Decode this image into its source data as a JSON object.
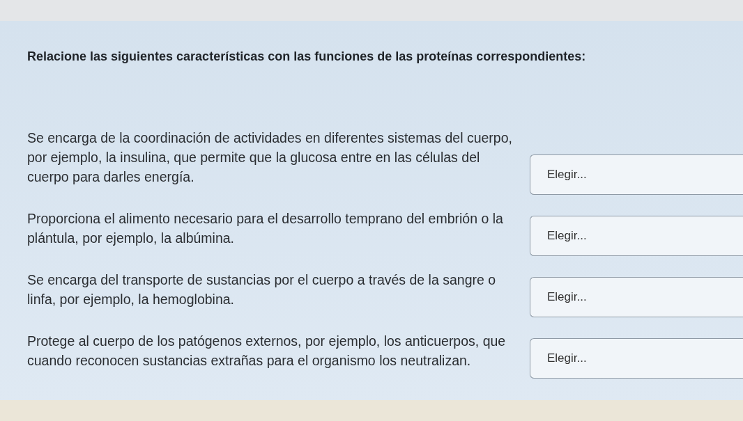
{
  "instruction": "Relacione las siguientes características con las funciones de las proteínas correspondientes:",
  "items": [
    {
      "statement": "Se encarga de la coordinación de actividades en diferentes sistemas del cuerpo, por ejemplo, la insulina, que permite que la glucosa entre en las células del cuerpo para darles energía.",
      "answer": {
        "placeholder": "Elegir..."
      }
    },
    {
      "statement": "Proporciona el alimento necesario para el desarrollo temprano del embrión o la plántula, por ejemplo, la albúmina.",
      "answer": {
        "placeholder": "Elegir..."
      }
    },
    {
      "statement": "Se encarga del transporte de sustancias por el cuerpo a través de la sangre o linfa, por ejemplo, la hemoglobina.",
      "answer": {
        "placeholder": "Elegir..."
      }
    },
    {
      "statement": "Protege al cuerpo de los patógenos externos, por ejemplo, los anticuerpos, que cuando reconocen sustancias extrañas para el organismo los neutralizan.",
      "answer": {
        "placeholder": "Elegir..."
      }
    }
  ]
}
